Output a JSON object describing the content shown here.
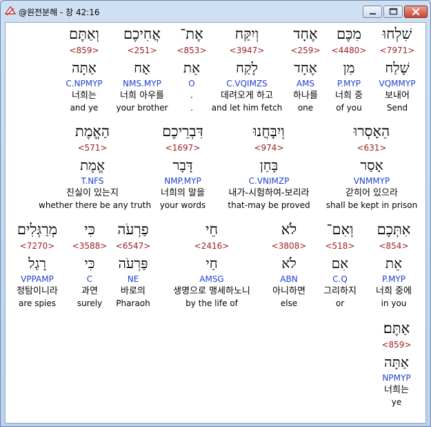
{
  "window": {
    "title": "@원전분해 - 창 42:16"
  },
  "rows": [
    [
      {
        "heb": "שִׁלְחוּ",
        "strong": "<7971>",
        "lemma": "שָׁלַח",
        "parse": "VQMMYP",
        "kor": "보내어",
        "eng": "Send"
      },
      {
        "heb": "מִכֶּם",
        "strong": "<4480>",
        "lemma": "מִן",
        "parse": "P.MYP",
        "kor": "너희 중",
        "eng": "of you"
      },
      {
        "heb": "אֶחָד",
        "strong": "<259>",
        "lemma": "אֶחָד",
        "parse": "AMS",
        "kor": "하나를",
        "eng": "one"
      },
      {
        "heb": "וְיִקַּח",
        "strong": "<3947>",
        "lemma": "לָקַח",
        "parse": "C.VQIMZS",
        "kor": "데려오게 하고",
        "eng": "and let him fetch"
      },
      {
        "heb": "אֶת־",
        "strong": "<853>",
        "lemma": "אֵת",
        "parse": "O",
        "kor": ".",
        "eng": "."
      },
      {
        "heb": "אֲחִיכֶם",
        "strong": "<251>",
        "lemma": "אָח",
        "parse": "NMS.MYP",
        "kor": "너희 아우를",
        "eng": "your brother"
      },
      {
        "heb": "וְאַתֶּם",
        "strong": "<859>",
        "lemma": "אַתָּה",
        "parse": "C.NPMYP",
        "kor": "너희는",
        "eng": "and ye"
      }
    ],
    [
      {
        "heb": "הֵאָסְרוּ",
        "strong": "<631>",
        "lemma": "אָסַר",
        "parse": "VNMMYP",
        "kor": "갇히어 있으라",
        "eng": "shall be kept in prison"
      },
      {
        "heb": "וְיִבָּחֲנוּ",
        "strong": "<974>",
        "lemma": "בָּחַן",
        "parse": "C.VNIMZP",
        "kor": "내가-시험하여-보리라",
        "eng": "that-may be proved"
      },
      {
        "heb": "דִּבְרֵיכֶם",
        "strong": "<1697>",
        "lemma": "דָּבָר",
        "parse": "NMP.MYP",
        "kor": "너희의 말을",
        "eng": "your words"
      },
      {
        "heb": "הַאֱמֶת",
        "strong": "<571>",
        "lemma": "אֱמֶת",
        "parse": "T.NFS",
        "kor": "진실이 있는지",
        "eng": "whether there be any truth"
      }
    ],
    [
      {
        "heb": "אִתְּכֶם",
        "strong": "<854>",
        "lemma": "אֵת",
        "parse": "P.MYP",
        "kor": "너희 중에",
        "eng": "in you"
      },
      {
        "heb": "וְאִם־",
        "strong": "<518>",
        "lemma": "אִם",
        "parse": "C.Q",
        "kor": "그리하지",
        "eng": "or"
      },
      {
        "heb": "לֹא",
        "strong": "<3808>",
        "lemma": "לֹא",
        "parse": "ABN",
        "kor": "아니하면",
        "eng": "else"
      },
      {
        "heb": "חֵי",
        "strong": "<2416>",
        "lemma": "חַי",
        "parse": "AMSG",
        "kor": "생명으로 맹세하노니",
        "eng": "by the life of"
      },
      {
        "heb": "פַרְעֹה",
        "strong": "<6547>",
        "lemma": "פַּרְעֹה",
        "parse": "NE",
        "kor": "바로의",
        "eng": "Pharaoh"
      },
      {
        "heb": "כִּי",
        "strong": "<3588>",
        "lemma": "כִּי",
        "parse": "C",
        "kor": "과연",
        "eng": "surely"
      },
      {
        "heb": "מְרַגְּלִים",
        "strong": "<7270>",
        "lemma": "רָגַל",
        "parse": "VPPAMP",
        "kor": "정탐이니라",
        "eng": "are spies"
      }
    ],
    [
      {
        "heb": "אַתֶּם׃",
        "strong": "<859>",
        "lemma": "אַתָּה",
        "parse": "NPMYP",
        "kor": "너희는",
        "eng": "ye"
      }
    ]
  ]
}
